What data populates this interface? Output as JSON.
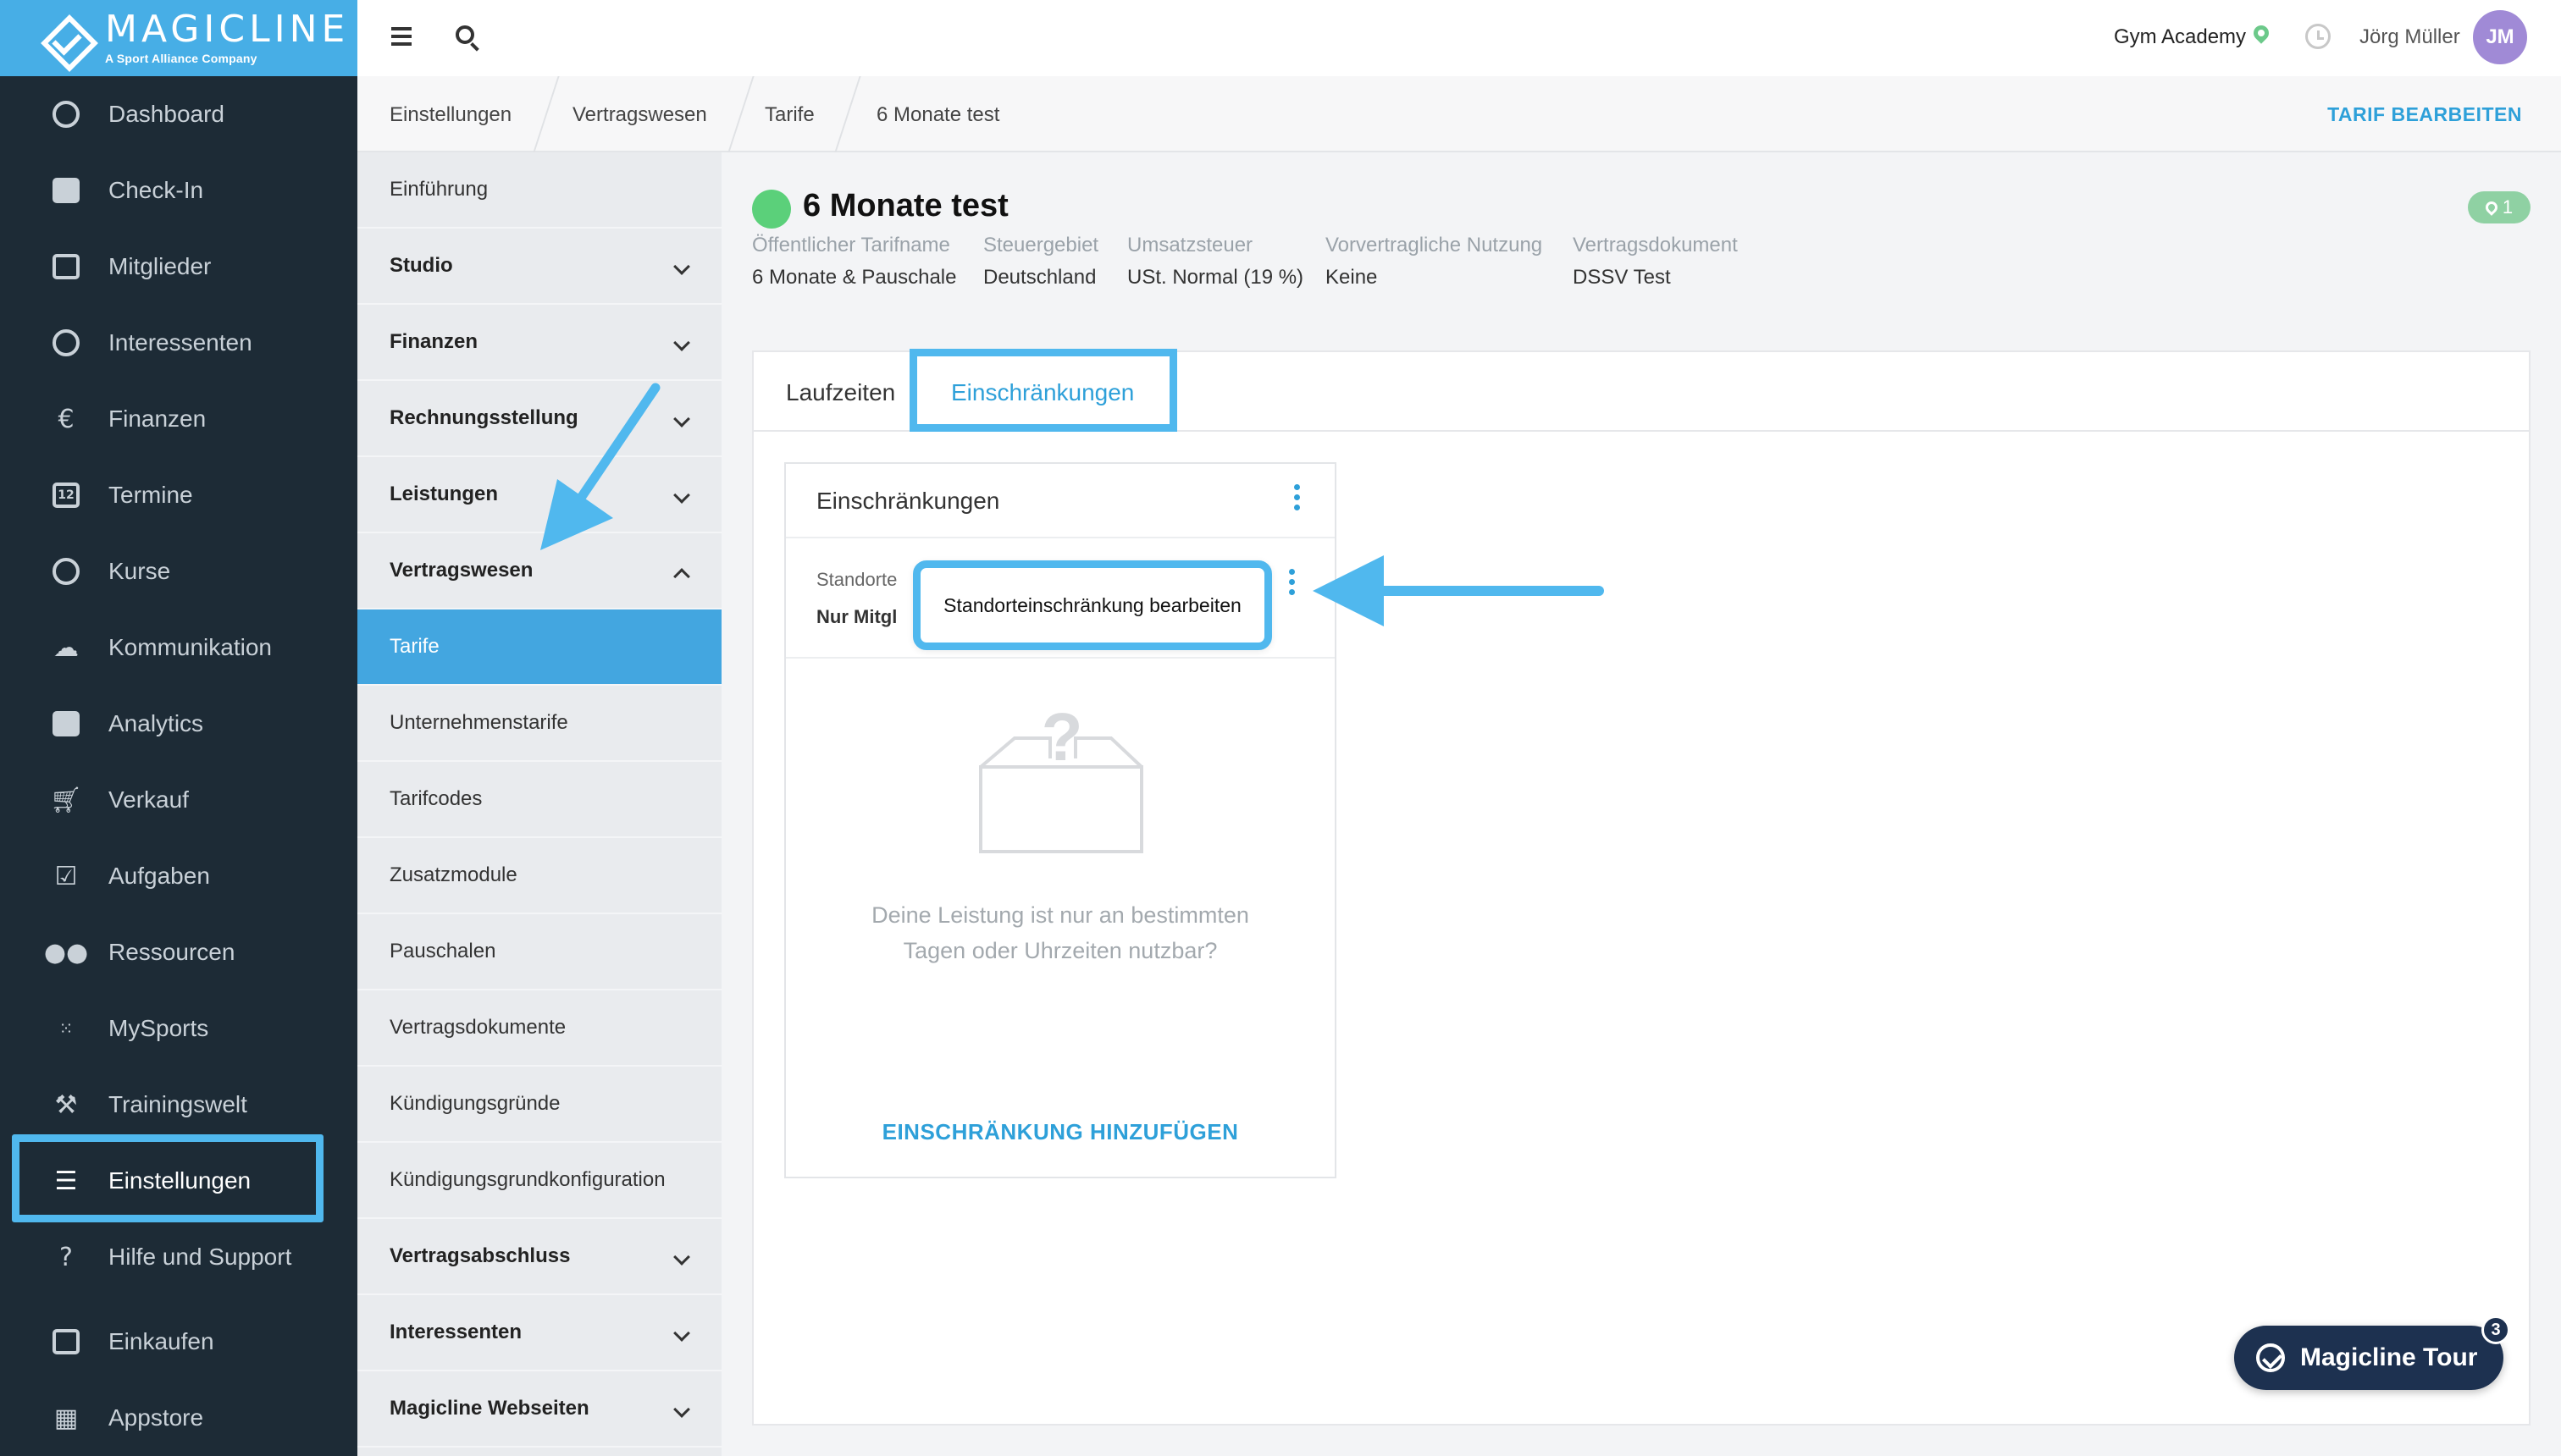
{
  "brand": {
    "name": "MAGICLINE",
    "tagline": "A Sport Alliance Company"
  },
  "nav": {
    "items": [
      {
        "label": "Dashboard",
        "icon": "dashboard-icon"
      },
      {
        "label": "Check-In",
        "icon": "check-in-icon"
      },
      {
        "label": "Mitglieder",
        "icon": "members-icon"
      },
      {
        "label": "Interessenten",
        "icon": "prospects-icon"
      },
      {
        "label": "Finanzen",
        "icon": "euro-icon"
      },
      {
        "label": "Termine",
        "icon": "calendar-icon"
      },
      {
        "label": "Kurse",
        "icon": "stopwatch-icon"
      },
      {
        "label": "Kommunikation",
        "icon": "chat-icon"
      },
      {
        "label": "Analytics",
        "icon": "chart-icon"
      },
      {
        "label": "Verkauf",
        "icon": "cart-icon"
      },
      {
        "label": "Aufgaben",
        "icon": "checkbox-icon"
      },
      {
        "label": "Ressourcen",
        "icon": "people-icon"
      },
      {
        "label": "MySports",
        "icon": "dots-grid-icon"
      },
      {
        "label": "Trainingswelt",
        "icon": "dumbbell-icon"
      },
      {
        "label": "Einstellungen",
        "icon": "sliders-icon"
      },
      {
        "label": "Hilfe und Support",
        "icon": "help-icon"
      },
      {
        "label": "Einkaufen",
        "icon": "shop-icon"
      },
      {
        "label": "Appstore",
        "icon": "apps-icon"
      }
    ],
    "calendar_day": "12"
  },
  "topbar": {
    "studio": "Gym Academy",
    "user": "Jörg Müller",
    "avatar_initials": "JM"
  },
  "breadcrumb": {
    "items": [
      "Einstellungen",
      "Vertragswesen",
      "Tarife",
      "6 Monate test"
    ],
    "action": "TARIF BEARBEITEN"
  },
  "subnav": {
    "items": [
      {
        "label": "Einführung"
      },
      {
        "label": "Studio"
      },
      {
        "label": "Finanzen"
      },
      {
        "label": "Rechnungsstellung"
      },
      {
        "label": "Leistungen"
      },
      {
        "label": "Vertragswesen"
      },
      {
        "label": "Tarife"
      },
      {
        "label": "Unternehmenstarife"
      },
      {
        "label": "Tarifcodes"
      },
      {
        "label": "Zusatzmodule"
      },
      {
        "label": "Pauschalen"
      },
      {
        "label": "Vertragsdokumente"
      },
      {
        "label": "Kündigungsgründe"
      },
      {
        "label": "Kündigungsgrundkonfiguration"
      },
      {
        "label": "Vertragsabschluss"
      },
      {
        "label": "Interessenten"
      },
      {
        "label": "Magicline Webseiten"
      }
    ]
  },
  "tariff": {
    "title": "6 Monate test",
    "location_count": "1",
    "status_color": "#5bd07a",
    "meta": [
      {
        "label": "Öffentlicher Tarifname",
        "value": "6 Monate & Pauschale"
      },
      {
        "label": "Steuergebiet",
        "value": "Deutschland"
      },
      {
        "label": "Umsatzsteuer",
        "value": "USt. Normal (19 %)"
      },
      {
        "label": "Vorvertragliche Nutzung",
        "value": "Keine"
      },
      {
        "label": "Vertragsdokument",
        "value": "DSSV Test"
      }
    ]
  },
  "tabs": {
    "laufzeiten": "Laufzeiten",
    "einschraenkungen": "Einschränkungen"
  },
  "restrictions": {
    "title": "Einschränkungen",
    "location_label": "Standorte",
    "location_value": "Nur Mitgl",
    "popup": "Standorteinschränkung bearbeiten",
    "empty_line1": "Deine Leistung ist nur an bestimmten",
    "empty_line2": "Tagen oder Uhrzeiten nutzbar?",
    "add": "EINSCHRÄNKUNG HINZUFÜGEN"
  },
  "tour": {
    "label": "Magicline Tour",
    "count": "3"
  },
  "colors": {
    "accent": "#2ea0d9",
    "highlight": "#50b8ee",
    "nav_bg": "#1d2b36",
    "logo_bg": "#47aee6"
  }
}
